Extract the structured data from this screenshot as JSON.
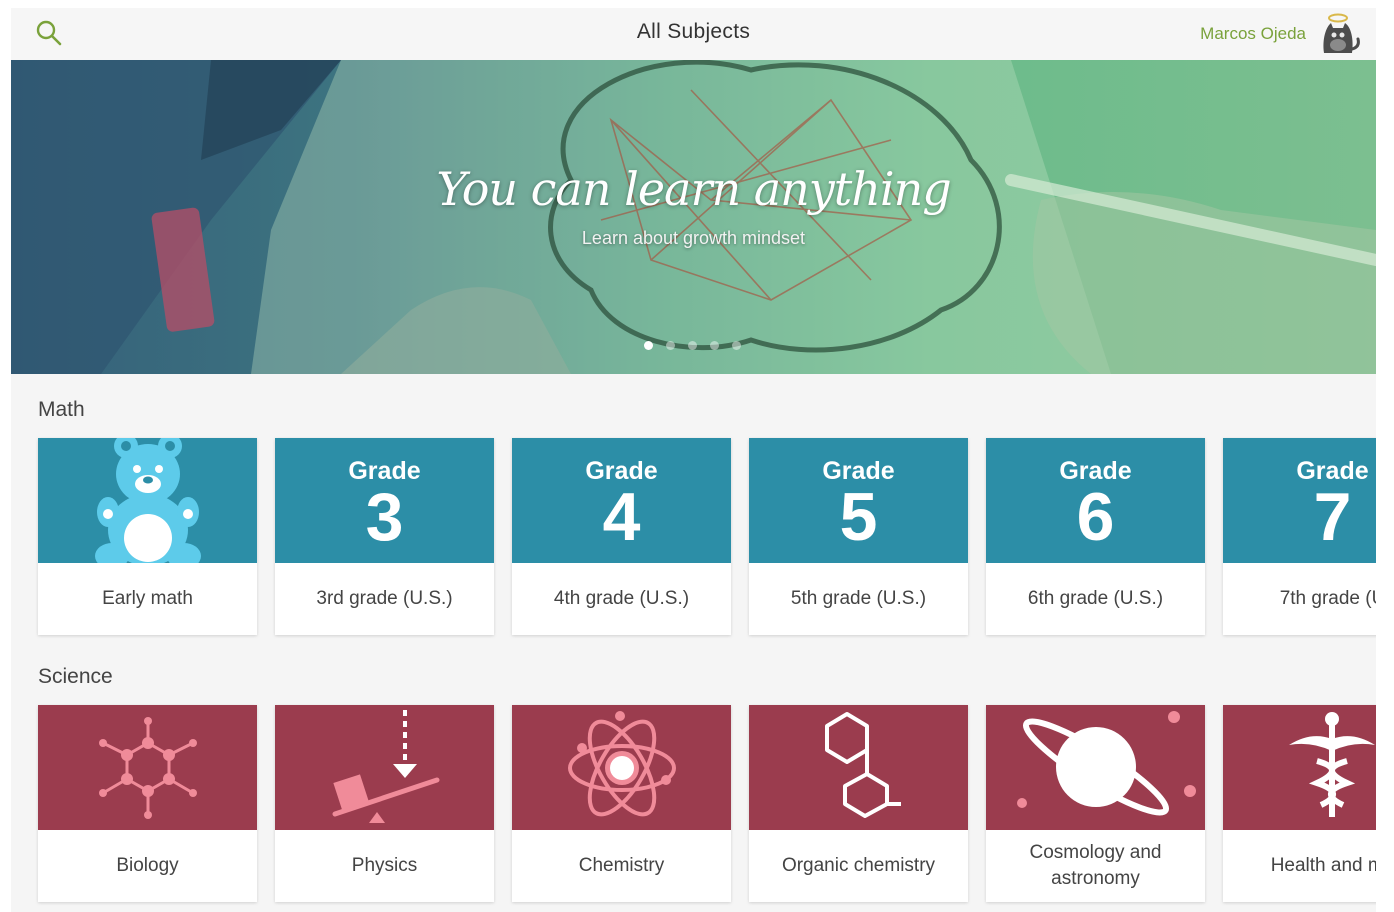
{
  "header": {
    "title": "All Subjects",
    "user_name": "Marcos Ojeda",
    "icons": {
      "search": "search-icon",
      "avatar": "cat-avatar-icon"
    }
  },
  "hero": {
    "title": "You can learn anything",
    "subtitle": "Learn about growth mindset",
    "slides": 5,
    "active_slide": 1
  },
  "colors": {
    "accent": "#7aa23b",
    "math": "#2c8ea7",
    "science": "#9b3c4e"
  },
  "math": {
    "title": "Math",
    "grade_word": "Grade",
    "items": [
      {
        "label": "Early math",
        "icon": "teddy-bear-icon"
      },
      {
        "label": "3rd grade (U.S.)",
        "number": "3"
      },
      {
        "label": "4th grade (U.S.)",
        "number": "4"
      },
      {
        "label": "5th grade (U.S.)",
        "number": "5"
      },
      {
        "label": "6th grade (U.S.)",
        "number": "6"
      },
      {
        "label": "7th grade (U",
        "number": "7"
      }
    ]
  },
  "science": {
    "title": "Science",
    "items": [
      {
        "label": "Biology",
        "icon": "molecule-icon"
      },
      {
        "label": "Physics",
        "icon": "lever-icon"
      },
      {
        "label": "Chemistry",
        "icon": "atom-icon"
      },
      {
        "label": "Organic chemistry",
        "icon": "hexagon-chain-icon"
      },
      {
        "label": "Cosmology and astronomy",
        "icon": "planet-icon"
      },
      {
        "label": "Health and me",
        "icon": "caduceus-icon"
      }
    ]
  }
}
